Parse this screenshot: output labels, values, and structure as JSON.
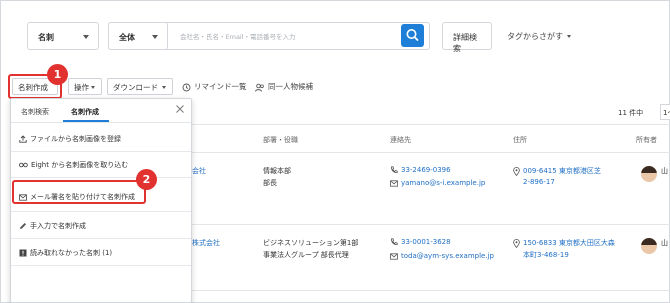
{
  "search": {
    "scope_select": "名刺",
    "field_select": "全体",
    "placeholder": "会社名・氏名・Email・電話番号を入力",
    "detail_button": "詳細検索",
    "tag_search": "タグからさがす"
  },
  "toolbar": {
    "create_card": "名刺作成",
    "operation": "操作",
    "download": "ダウンロード",
    "reminder": "リマインド一覧",
    "same_person": "同一人物候補"
  },
  "badges": {
    "one": "1",
    "two": "2"
  },
  "dropdown": {
    "tabs": [
      "名刺検索",
      "名刺作成"
    ],
    "active_tab": "名刺作成",
    "items": [
      {
        "label": "ファイルから名刺画像を登録",
        "icon": "upload-icon"
      },
      {
        "label": "Eight から名刺画像を取り込む",
        "icon": "eight-logo-icon"
      },
      {
        "label": "メール署名を貼り付けて名刺作成",
        "icon": "mail-icon"
      },
      {
        "label": "手入力で名刺作成",
        "icon": "pencil-icon"
      },
      {
        "label": "読み取れなかった名刺 (1)",
        "icon": "alert-icon"
      }
    ]
  },
  "pagination": {
    "count": "11 件中",
    "page_select": "1〜"
  },
  "table": {
    "headers": {
      "department": "部署・役職",
      "contact": "連絡先",
      "address": "住所",
      "owner": "所有者"
    },
    "rows": [
      {
        "company_suffix": "会社",
        "dept": "情報本部",
        "title": "部長",
        "phone": "33-2469-0396",
        "email": "yamano@s-i.example.jp",
        "address1": "009-6415 東京都港区芝",
        "address2": "2-896-17",
        "owner_initial": "山"
      },
      {
        "company_suffix": "株式会社",
        "dept": "ビジネスソリューション第1部",
        "title": "事業法人グループ 部長代理",
        "phone": "33-0001-3628",
        "email": "toda@aym-sys.example.jp",
        "address1": "150-6833 東京都大田区大森",
        "address2": "本町3-468-19",
        "owner_initial": "山"
      }
    ]
  },
  "colors": {
    "accent": "#1f7ed8",
    "badge": "#e2322f"
  }
}
